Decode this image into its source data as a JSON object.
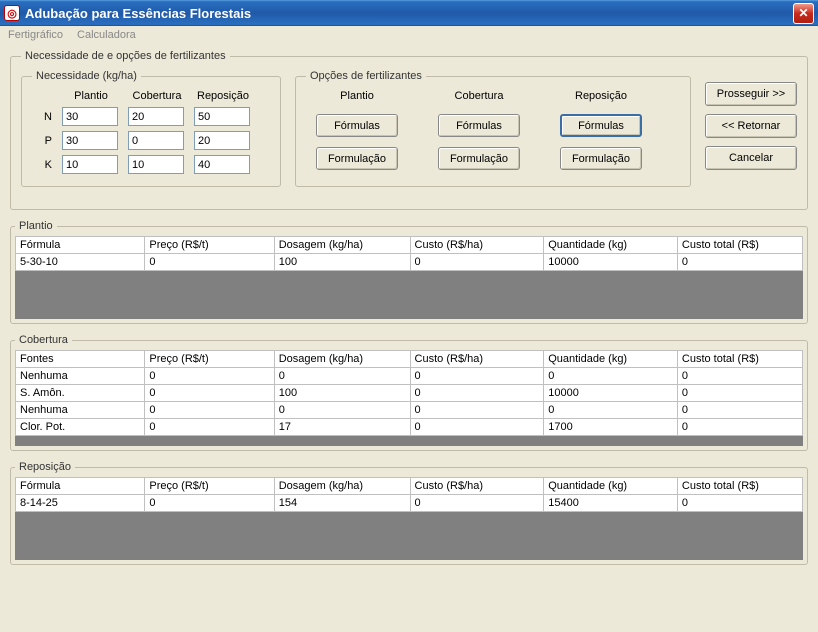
{
  "window": {
    "title": "Adubação para Essências Florestais"
  },
  "menu": {
    "fertigrafico": "Fertigráfico",
    "calculadora": "Calculadora"
  },
  "legends": {
    "main": "Necessidade de e opções de fertilizantes",
    "need": "Necessidade (kg/ha)",
    "opts": "Opções de fertilizantes",
    "plantio": "Plantio",
    "cobertura": "Cobertura",
    "reposicao": "Reposição"
  },
  "need": {
    "cols": {
      "plantio": "Plantio",
      "cobertura": "Cobertura",
      "reposicao": "Reposição"
    },
    "rows": {
      "N": {
        "label": "N",
        "plantio": "30",
        "cobertura": "20",
        "reposicao": "50"
      },
      "P": {
        "label": "P",
        "plantio": "30",
        "cobertura": "0",
        "reposicao": "20"
      },
      "K": {
        "label": "K",
        "plantio": "10",
        "cobertura": "10",
        "reposicao": "40"
      }
    }
  },
  "opts": {
    "cols": {
      "plantio": "Plantio",
      "cobertura": "Cobertura",
      "reposicao": "Reposição"
    },
    "btn_formulas": "Fórmulas",
    "btn_formulacao": "Formulação"
  },
  "side": {
    "prosseguir": "Prosseguir >>",
    "retornar": "<< Retornar",
    "cancelar": "Cancelar"
  },
  "table_headers": {
    "formula": "Fórmula",
    "fontes": "Fontes",
    "preco": "Preço (R$/t)",
    "dosagem": "Dosagem (kg/ha)",
    "custo": "Custo (R$/ha)",
    "quantidade": "Quantidade (kg)",
    "custo_total": "Custo total (R$)"
  },
  "plantio_rows": [
    {
      "formula": "5-30-10",
      "preco": "0",
      "dosagem": "100",
      "custo": "0",
      "quantidade": "10000",
      "custo_total": "0"
    }
  ],
  "cobertura_rows": [
    {
      "fontes": "Nenhuma",
      "preco": "0",
      "dosagem": "0",
      "custo": "0",
      "quantidade": "0",
      "custo_total": "0"
    },
    {
      "fontes": "S. Amôn.",
      "preco": "0",
      "dosagem": "100",
      "custo": "0",
      "quantidade": "10000",
      "custo_total": "0"
    },
    {
      "fontes": "Nenhuma",
      "preco": "0",
      "dosagem": "0",
      "custo": "0",
      "quantidade": "0",
      "custo_total": "0"
    },
    {
      "fontes": "Clor. Pot.",
      "preco": "0",
      "dosagem": "17",
      "custo": "0",
      "quantidade": "1700",
      "custo_total": "0"
    }
  ],
  "reposicao_rows": [
    {
      "formula": "8-14-25",
      "preco": "0",
      "dosagem": "154",
      "custo": "0",
      "quantidade": "15400",
      "custo_total": "0"
    }
  ]
}
